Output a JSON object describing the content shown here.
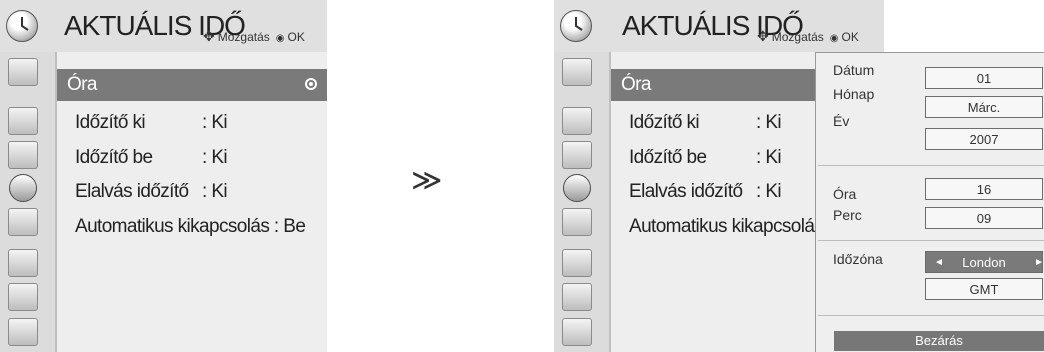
{
  "left_screen": {
    "title": "AKTUÁLIS IDŐ",
    "hint": {
      "move_icon": "move-arrows-icon",
      "move_label": "Mozgatás",
      "ok_label": "OK"
    },
    "menu": [
      {
        "label": "Óra",
        "value": "",
        "selected": true
      },
      {
        "label": "Időzítő ki",
        "value": ": Ki"
      },
      {
        "label": "Időzítő be",
        "value": ": Ki"
      },
      {
        "label": "Elalvás időzítő",
        "value": ": Ki"
      },
      {
        "label": "Automatikus kikapcsolás : Be",
        "value": ""
      }
    ]
  },
  "right_screen": {
    "title": "AKTUÁLIS IDŐ",
    "hint": {
      "move_label": "Mozgatás",
      "ok_label": "OK"
    },
    "menu": [
      {
        "label": "Óra",
        "value": "",
        "selected": true
      },
      {
        "label": "Időzítő ki",
        "value": ": Ki"
      },
      {
        "label": "Időzítő be",
        "value": ": Ki"
      },
      {
        "label": "Elalvás időzítő",
        "value": ": Ki"
      },
      {
        "label": "Automatikus kikapcsolá",
        "value": ""
      }
    ],
    "panel": {
      "date_label": "Dátum",
      "date_value": "01",
      "month_label": "Hónap",
      "month_value": "Márc.",
      "year_label": "Év",
      "year_value": "2007",
      "hour_label": "Óra",
      "hour_value": "16",
      "minute_label": "Perc",
      "minute_value": "09",
      "timezone_label": "Időzóna",
      "timezone_value": "London",
      "timezone_offset": "GMT",
      "close_label": "Bezárás"
    }
  },
  "transition_arrow": "≫",
  "sidebar_icons": [
    "picture-icon",
    "screen-icon",
    "speaker-icon",
    "clock-icon",
    "settings-icon",
    "lock-icon",
    "input-icon",
    "usb-icon"
  ],
  "colors": {
    "titlebar": "#e0e0e0",
    "selected": "#7a7a7a",
    "menu_bg": "#eeeeee"
  }
}
